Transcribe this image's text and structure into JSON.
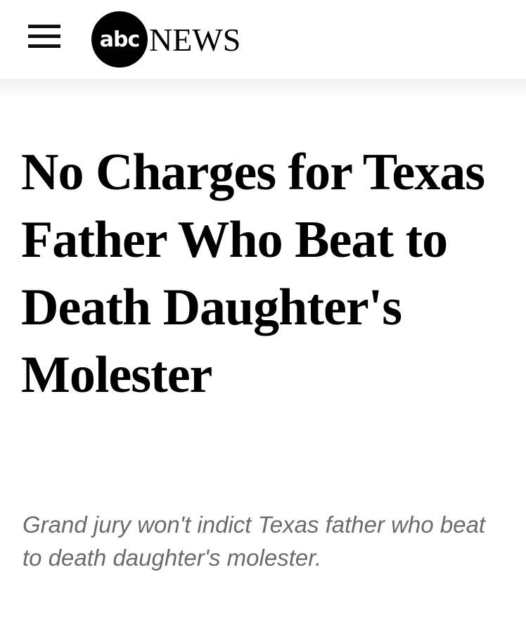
{
  "header": {
    "logo_mark": "abc",
    "logo_text": "NEWS",
    "menu_icon": "hamburger-menu-icon"
  },
  "article": {
    "headline": "No Charges for Texas Father Who Beat to Death Daughter's Molester",
    "subheadline": "Grand jury won't indict Texas father who beat to death daughter's molester."
  },
  "colors": {
    "text": "#000000",
    "subheadline": "#6b6b6b",
    "background": "#ffffff"
  }
}
